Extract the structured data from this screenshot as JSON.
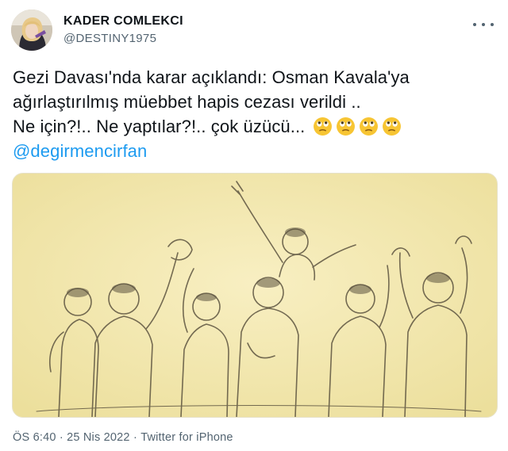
{
  "author": {
    "display_name": "KADER COMLEKCI",
    "handle": "@DESTINY1975"
  },
  "tweet": {
    "line1": "Gezi Davası'nda karar açıklandı: Osman Kavala'ya",
    "line2": "ağırlaştırılmış müebbet hapis cezası verildi ..",
    "line3": "Ne için?!.. Ne yaptılar?!.. çok üzücü...",
    "emojis": [
      "face-with-rolling-eyes",
      "face-with-rolling-eyes",
      "face-with-rolling-eyes",
      "face-with-rolling-eyes"
    ],
    "mention": "@degirmencirfan"
  },
  "media": {
    "type": "illustration",
    "background_color": "#f3e9b3"
  },
  "meta": {
    "time": "ÖS 6:40",
    "separator": "·",
    "date": "25 Nis 2022",
    "source": "Twitter for iPhone"
  },
  "colors": {
    "link": "#1d9bf0",
    "secondary_text": "#536471",
    "primary_text": "#0f1419"
  }
}
